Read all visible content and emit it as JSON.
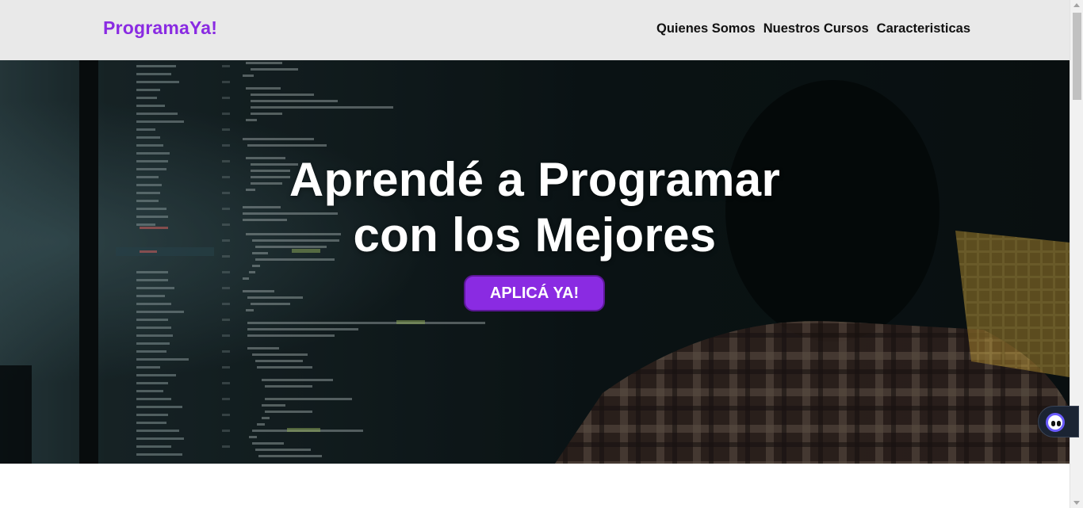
{
  "header": {
    "brand": "ProgramaYa!",
    "nav": [
      {
        "label": "Quienes Somos"
      },
      {
        "label": "Nuestros Cursos"
      },
      {
        "label": "Caracteristicas"
      }
    ]
  },
  "hero": {
    "title_line1": "Aprendé a Programar",
    "title_line2": "con los Mejores",
    "cta_label": "APLICÁ YA!"
  },
  "icons": {
    "widget": "chat-assistant-icon"
  },
  "colors": {
    "brand": "#8a2be2",
    "header_bg": "#e9e9e9",
    "hero_overlay": "#0f1a1c"
  }
}
